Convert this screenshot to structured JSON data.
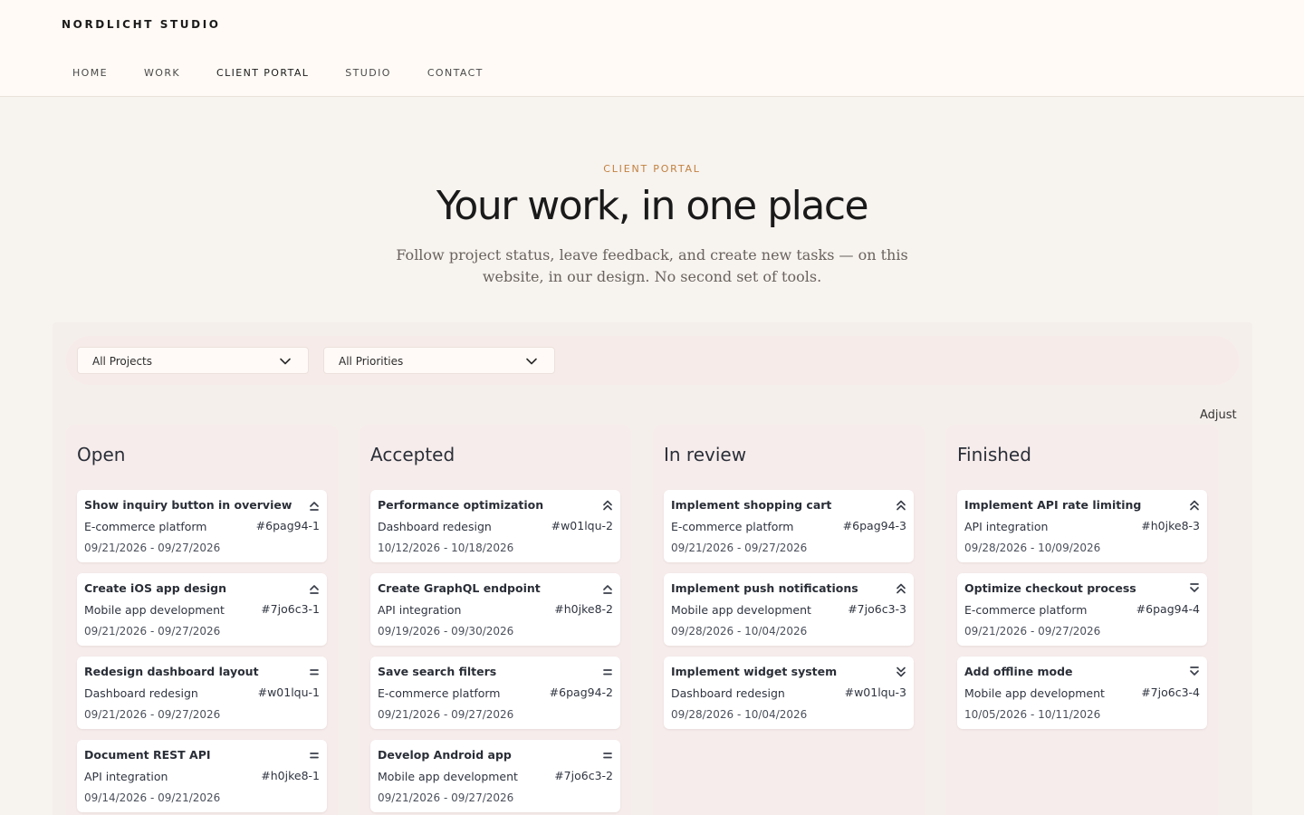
{
  "header": {
    "logo": "NORDLICHT STUDIO",
    "nav": [
      "HOME",
      "WORK",
      "CLIENT PORTAL",
      "STUDIO",
      "CONTACT"
    ],
    "active_nav": "CLIENT PORTAL"
  },
  "hero": {
    "eyebrow": "CLIENT PORTAL",
    "title": "Your work, in one place",
    "subtitle": "Follow project status, leave feedback, and create new tasks — on this website, in our design. No second set of tools."
  },
  "filters": {
    "project": "All Projects",
    "priority": "All Priorities"
  },
  "adjust_label": "Adjust",
  "colors": {
    "accent": "#c2813f",
    "column_bg": "#f6eceb",
    "card_bg": "#ffffff",
    "icon": "#3a3f4a"
  },
  "columns": [
    {
      "title": "Open",
      "cards": [
        {
          "title": "Show inquiry button in overview",
          "project": "E-commerce platform",
          "id": "#6pag94-1",
          "dates": "09/21/2026 - 09/27/2026",
          "priority": "high",
          "priority_icon": "chevron-up-icon"
        },
        {
          "title": "Create iOS app design",
          "project": "Mobile app development",
          "id": "#7jo6c3-1",
          "dates": "09/21/2026 - 09/27/2026",
          "priority": "high",
          "priority_icon": "chevron-up-icon"
        },
        {
          "title": "Redesign dashboard layout",
          "project": "Dashboard redesign",
          "id": "#w01lqu-1",
          "dates": "09/21/2026 - 09/27/2026",
          "priority": "medium",
          "priority_icon": "equals-icon"
        },
        {
          "title": "Document REST API",
          "project": "API integration",
          "id": "#h0jke8-1",
          "dates": "09/14/2026 - 09/21/2026",
          "priority": "medium",
          "priority_icon": "equals-icon"
        }
      ]
    },
    {
      "title": "Accepted",
      "cards": [
        {
          "title": "Performance optimization",
          "project": "Dashboard redesign",
          "id": "#w01lqu-2",
          "dates": "10/12/2026 - 10/18/2026",
          "priority": "highest",
          "priority_icon": "double-chevron-up-icon"
        },
        {
          "title": "Create GraphQL endpoint",
          "project": "API integration",
          "id": "#h0jke8-2",
          "dates": "09/19/2026 - 09/30/2026",
          "priority": "high",
          "priority_icon": "chevron-up-icon"
        },
        {
          "title": "Save search filters",
          "project": "E-commerce platform",
          "id": "#6pag94-2",
          "dates": "09/21/2026 - 09/27/2026",
          "priority": "medium",
          "priority_icon": "equals-icon"
        },
        {
          "title": "Develop Android app",
          "project": "Mobile app development",
          "id": "#7jo6c3-2",
          "dates": "09/21/2026 - 09/27/2026",
          "priority": "medium",
          "priority_icon": "equals-icon"
        }
      ]
    },
    {
      "title": "In review",
      "cards": [
        {
          "title": "Implement shopping cart",
          "project": "E-commerce platform",
          "id": "#6pag94-3",
          "dates": "09/21/2026 - 09/27/2026",
          "priority": "highest",
          "priority_icon": "double-chevron-up-icon"
        },
        {
          "title": "Implement push notifications",
          "project": "Mobile app development",
          "id": "#7jo6c3-3",
          "dates": "09/28/2026 - 10/04/2026",
          "priority": "highest",
          "priority_icon": "double-chevron-up-icon"
        },
        {
          "title": "Implement widget system",
          "project": "Dashboard redesign",
          "id": "#w01lqu-3",
          "dates": "09/28/2026 - 10/04/2026",
          "priority": "lowest",
          "priority_icon": "double-chevron-down-icon"
        }
      ]
    },
    {
      "title": "Finished",
      "cards": [
        {
          "title": "Implement API rate limiting",
          "project": "API integration",
          "id": "#h0jke8-3",
          "dates": "09/28/2026 - 10/09/2026",
          "priority": "highest",
          "priority_icon": "double-chevron-up-icon"
        },
        {
          "title": "Optimize checkout process",
          "project": "E-commerce platform",
          "id": "#6pag94-4",
          "dates": "09/21/2026 - 09/27/2026",
          "priority": "low",
          "priority_icon": "chevron-down-icon"
        },
        {
          "title": "Add offline mode",
          "project": "Mobile app development",
          "id": "#7jo6c3-4",
          "dates": "10/05/2026 - 10/11/2026",
          "priority": "low",
          "priority_icon": "chevron-down-icon"
        }
      ]
    }
  ]
}
